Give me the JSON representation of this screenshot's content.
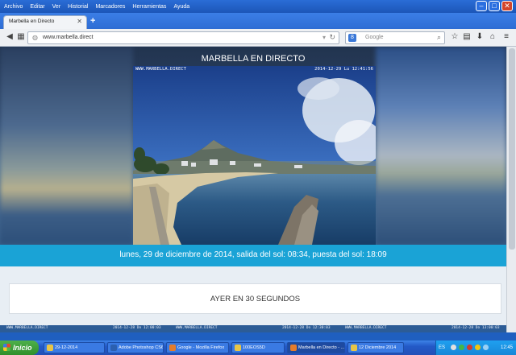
{
  "browser": {
    "menu": [
      "Archivo",
      "Editar",
      "Ver",
      "Historial",
      "Marcadores",
      "Herramientas",
      "Ayuda"
    ],
    "tab_title": "Marbella en Directo",
    "url": "www.marbella.direct",
    "search_placeholder": "Google",
    "search_engine_badge": "8"
  },
  "page": {
    "title": "MARBELLA EN DIRECTO",
    "cam_label_left": "WWW.MARBELLA.DIRECT",
    "cam_label_right": "2014-12-29 Lu 12:41:56",
    "info": "lunes, 29 de diciembre de 2014, salida del sol: 08:34, puesta del sol: 18:09",
    "ayer_button": "AYER EN 30 SEGUNDOS",
    "thumb_labels": [
      "WWW.MARBELLA.DIRECT",
      "2014-12-28 Do 12:00:03",
      "WWW.MARBELLA.DIRECT",
      "2014-12-28 Do 12:30:03",
      "WWW.MARBELLA.DIRECT",
      "2014-12-28 Do 13:00:03"
    ]
  },
  "taskbar": {
    "start": "Inicio",
    "items": [
      "29-12-2014",
      "Adobe Photoshop CS6",
      "Google - Mozilla Firefox",
      "100EOS5D",
      "Marbella en Directo - ...",
      "12 Diciembre 2014"
    ],
    "language": "ES",
    "clock": "12:45"
  },
  "colors": {
    "info_bar": "#1aa3d6",
    "taskbar": "#2359c7",
    "start_button": "#3f9f3a"
  }
}
